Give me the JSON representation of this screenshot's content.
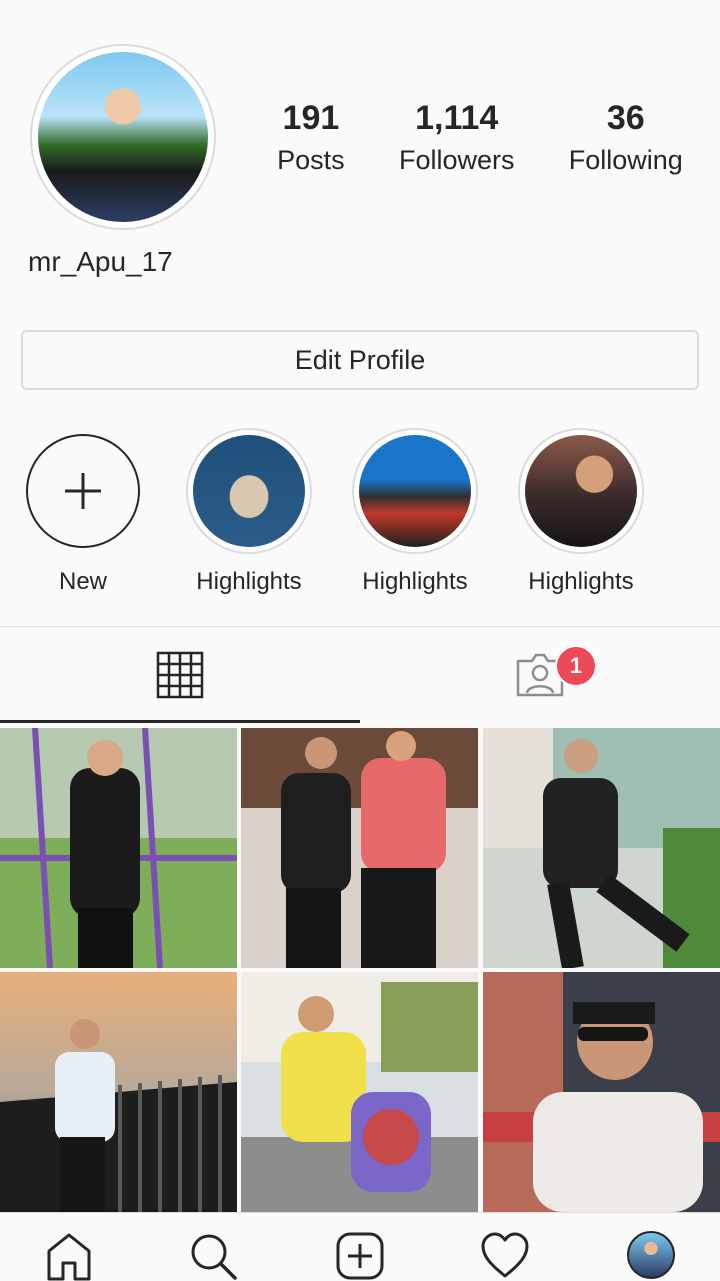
{
  "profile": {
    "username": "mr_Apu_17",
    "edit_label": "Edit Profile"
  },
  "stats": [
    {
      "value": "191",
      "label": "Posts"
    },
    {
      "value": "1,114",
      "label": "Followers"
    },
    {
      "value": "36",
      "label": "Following"
    }
  ],
  "highlights": [
    {
      "label": "New"
    },
    {
      "label": "Highlights"
    },
    {
      "label": "Highlights"
    },
    {
      "label": "Highlights"
    }
  ],
  "tabs": {
    "grid_icon": "grid-icon",
    "tagged_icon": "tagged-person-icon",
    "tagged_badge": "1"
  },
  "nav": [
    "home-icon",
    "search-icon",
    "new-post-icon",
    "activity-heart-icon",
    "profile-avatar"
  ],
  "colors": {
    "badge": "#ed4956",
    "text": "#262626",
    "divider": "#dbdbdb"
  }
}
